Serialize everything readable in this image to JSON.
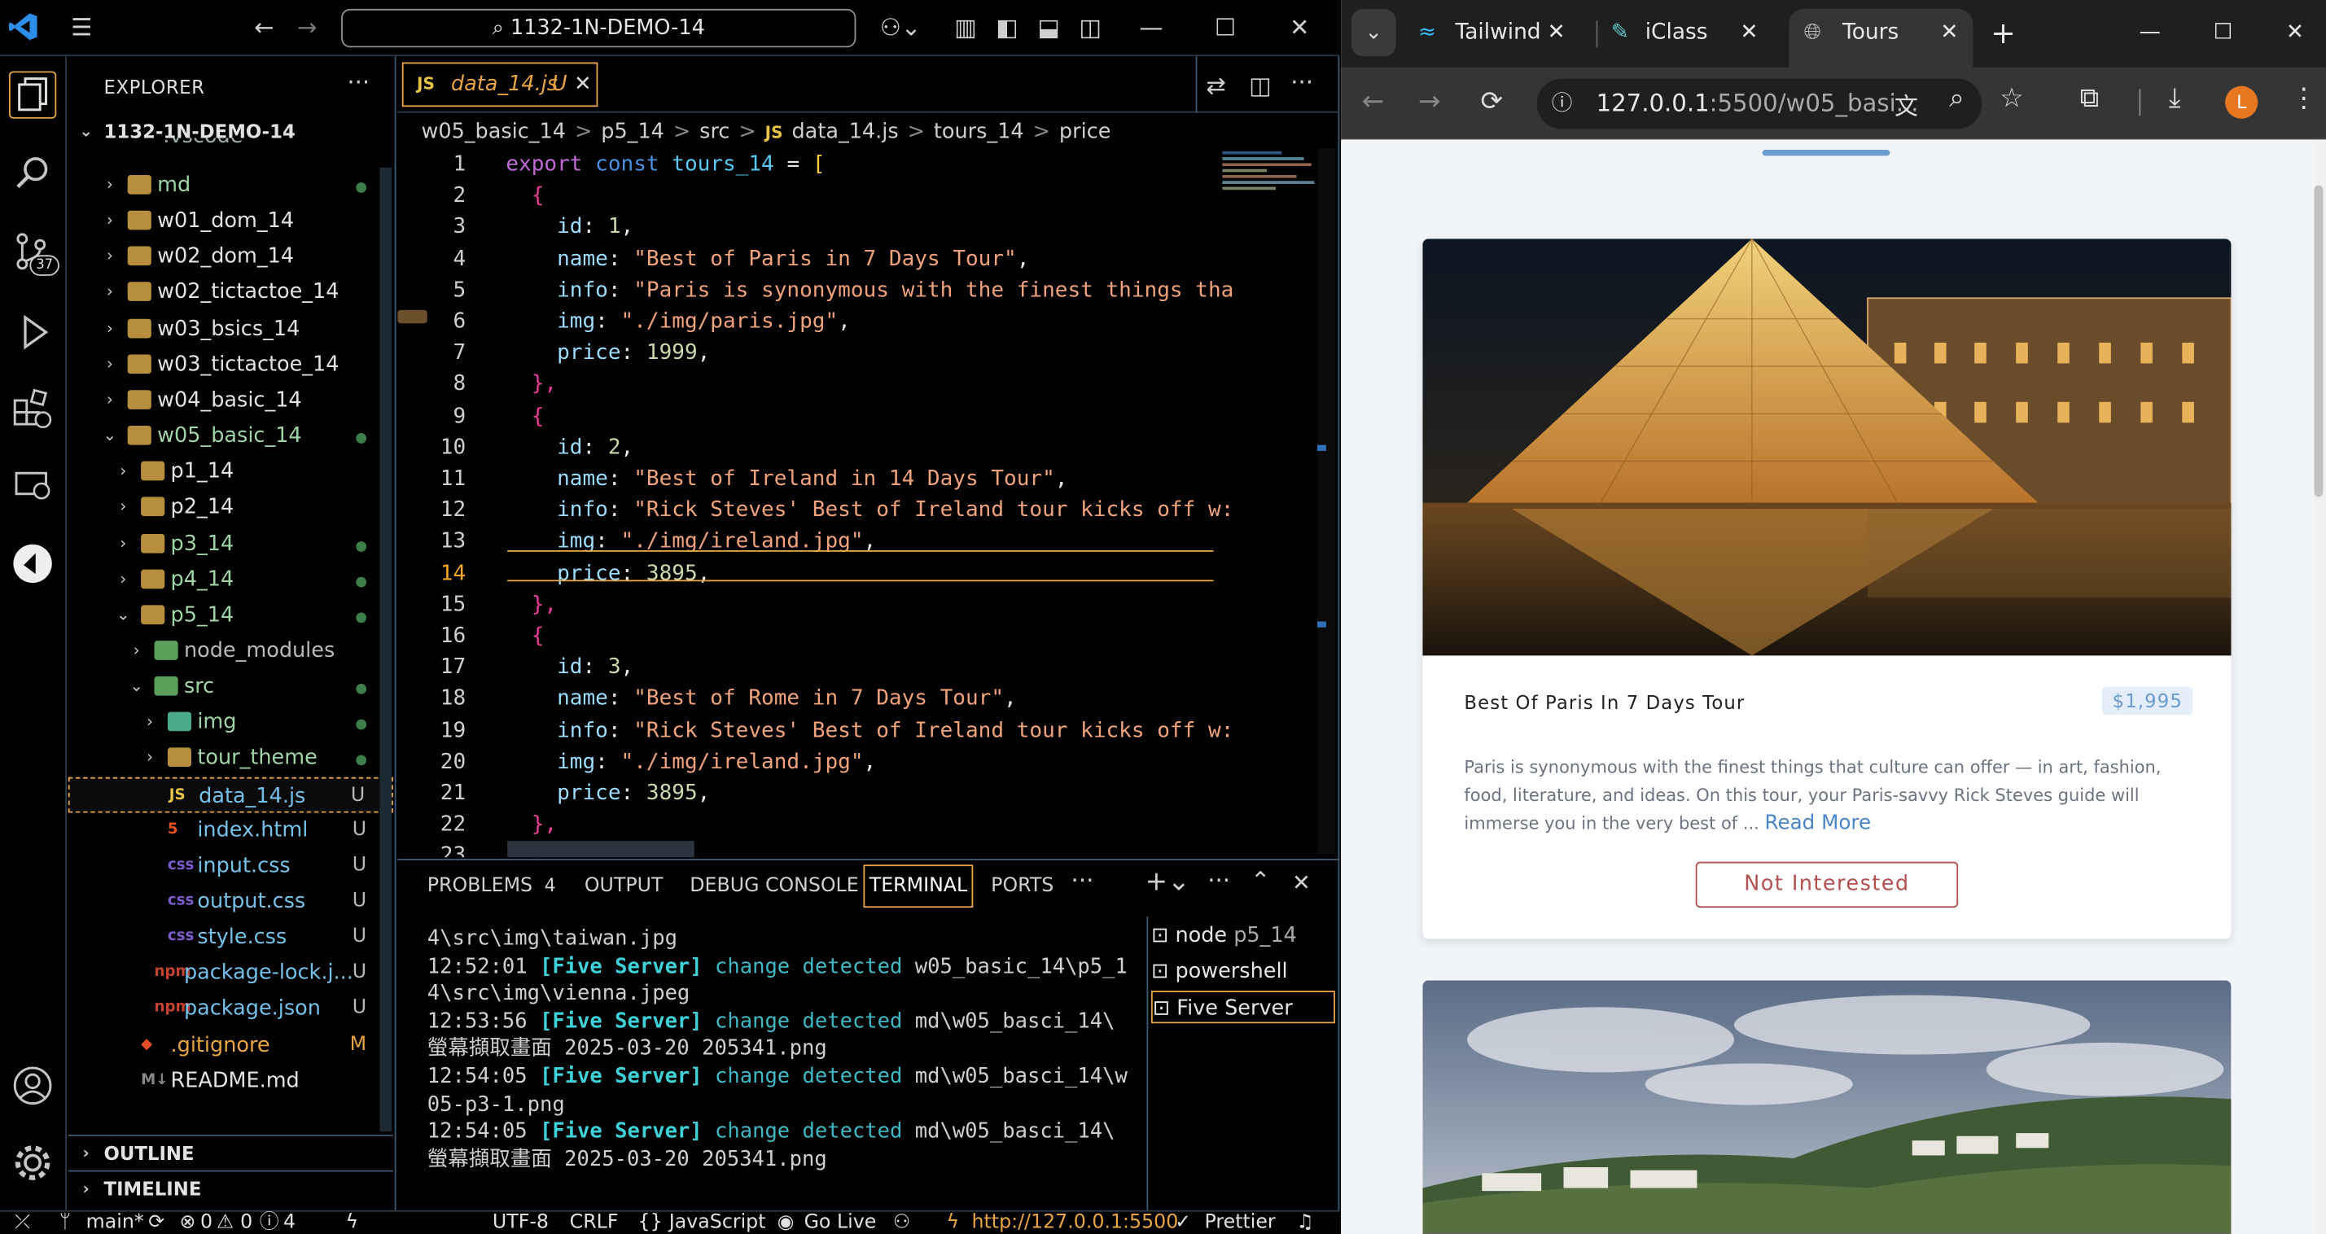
{
  "vscode": {
    "search_text": "1132-1N-DEMO-14",
    "explorer_title": "EXPLORER",
    "root_folder": "1132-1N-DEMO-14",
    "partial_item": ".vscode",
    "tree": [
      {
        "label": "md",
        "depth": 0,
        "kind": "folder",
        "badge": "dot"
      },
      {
        "label": "w01_dom_14",
        "depth": 0,
        "kind": "folder",
        "badge": ""
      },
      {
        "label": "w02_dom_14",
        "depth": 0,
        "kind": "folder",
        "badge": ""
      },
      {
        "label": "w02_tictactoe_14",
        "depth": 0,
        "kind": "folder",
        "badge": ""
      },
      {
        "label": "w03_bsics_14",
        "depth": 0,
        "kind": "folder",
        "badge": ""
      },
      {
        "label": "w03_tictactoe_14",
        "depth": 0,
        "kind": "folder",
        "badge": ""
      },
      {
        "label": "w04_basic_14",
        "depth": 0,
        "kind": "folder",
        "badge": ""
      },
      {
        "label": "w05_basic_14",
        "depth": 0,
        "kind": "folder-open",
        "badge": "dot"
      },
      {
        "label": "p1_14",
        "depth": 1,
        "kind": "folder",
        "badge": ""
      },
      {
        "label": "p2_14",
        "depth": 1,
        "kind": "folder",
        "badge": ""
      },
      {
        "label": "p3_14",
        "depth": 1,
        "kind": "folder",
        "badge": "dot"
      },
      {
        "label": "p4_14",
        "depth": 1,
        "kind": "folder",
        "badge": "dot"
      },
      {
        "label": "p5_14",
        "depth": 1,
        "kind": "folder-open",
        "badge": "dot"
      },
      {
        "label": "node_modules",
        "depth": 2,
        "kind": "folder-green",
        "badge": ""
      },
      {
        "label": "src",
        "depth": 2,
        "kind": "folder-green-open",
        "badge": "dot"
      },
      {
        "label": "img",
        "depth": 3,
        "kind": "folder-img",
        "badge": "dot"
      },
      {
        "label": "tour_theme",
        "depth": 3,
        "kind": "folder",
        "badge": "dot"
      },
      {
        "label": "data_14.js",
        "depth": 3,
        "kind": "js",
        "badge": "U"
      },
      {
        "label": "index.html",
        "depth": 3,
        "kind": "html",
        "badge": "U"
      },
      {
        "label": "input.css",
        "depth": 3,
        "kind": "css",
        "badge": "U"
      },
      {
        "label": "output.css",
        "depth": 3,
        "kind": "css",
        "badge": "U"
      },
      {
        "label": "style.css",
        "depth": 3,
        "kind": "css",
        "badge": "U"
      },
      {
        "label": "package-lock.j...",
        "depth": 2,
        "kind": "npm",
        "badge": "U"
      },
      {
        "label": "package.json",
        "depth": 2,
        "kind": "npm",
        "badge": "U"
      },
      {
        "label": ".gitignore",
        "depth": 1,
        "kind": "git",
        "badge": "M"
      },
      {
        "label": "README.md",
        "depth": 1,
        "kind": "md",
        "badge": ""
      }
    ],
    "outline": "OUTLINE",
    "timeline": "TIMELINE",
    "badge_count": "37",
    "tab_label": "data_14.js",
    "tab_badge": "U",
    "tab_icon": "JS",
    "breadcrumbs": [
      "w05_basic_14",
      ">",
      "p5_14",
      ">",
      "src",
      ">",
      "JS",
      "data_14.js",
      ">",
      "tours_14",
      ">",
      "price"
    ],
    "code": [
      {
        "n": "1",
        "t": "export const tours_14 = ["
      },
      {
        "n": "2",
        "t": "  {"
      },
      {
        "n": "3",
        "t": "    id: 1,"
      },
      {
        "n": "4",
        "t": "    name: \"Best of Paris in 7 Days Tour\","
      },
      {
        "n": "5",
        "t": "    info: \"Paris is synonymous with the finest things tha"
      },
      {
        "n": "6",
        "t": "    img: \"./img/paris.jpg\","
      },
      {
        "n": "7",
        "t": "    price: 1999,"
      },
      {
        "n": "8",
        "t": "  },"
      },
      {
        "n": "9",
        "t": "  {"
      },
      {
        "n": "10",
        "t": "    id: 2,"
      },
      {
        "n": "11",
        "t": "    name: \"Best of Ireland in 14 Days Tour\","
      },
      {
        "n": "12",
        "t": "    info: \"Rick Steves' Best of Ireland tour kicks off w:"
      },
      {
        "n": "13",
        "t": "    img: \"./img/ireland.jpg\","
      },
      {
        "n": "14",
        "t": "    price: 3895,"
      },
      {
        "n": "15",
        "t": "  },"
      },
      {
        "n": "16",
        "t": "  {"
      },
      {
        "n": "17",
        "t": "    id: 3,"
      },
      {
        "n": "18",
        "t": "    name: \"Best of Rome in 7 Days Tour\","
      },
      {
        "n": "19",
        "t": "    info: \"Rick Steves' Best of Ireland tour kicks off w:"
      },
      {
        "n": "20",
        "t": "    img: \"./img/ireland.jpg\","
      },
      {
        "n": "21",
        "t": "    price: 3895,"
      },
      {
        "n": "22",
        "t": "  },"
      },
      {
        "n": "23",
        "t": "  {"
      }
    ],
    "panel_tabs": {
      "problems": "PROBLEMS",
      "problems_count": "4",
      "output": "OUTPUT",
      "debug": "DEBUG CONSOLE",
      "terminal": "TERMINAL",
      "ports": "PORTS"
    },
    "terminal_lines": [
      [
        {
          "c": "",
          "t": "4\\src\\img\\taiwan.jpg"
        }
      ],
      [
        {
          "c": "",
          "t": "12:52:01 "
        },
        {
          "c": "fs",
          "t": "[Five Server]"
        },
        {
          "c": "cy",
          "t": " change detected "
        },
        {
          "c": "",
          "t": "w05_basic_14\\p5_1"
        }
      ],
      [
        {
          "c": "",
          "t": "4\\src\\img\\vienna.jpeg"
        }
      ],
      [
        {
          "c": "",
          "t": "12:53:56 "
        },
        {
          "c": "fs",
          "t": "[Five Server]"
        },
        {
          "c": "cy",
          "t": " change detected "
        },
        {
          "c": "",
          "t": "md\\w05_basci_14\\"
        }
      ],
      [
        {
          "c": "",
          "t": "螢幕擷取畫面 2025-03-20 205341.png"
        }
      ],
      [
        {
          "c": "",
          "t": "12:54:05 "
        },
        {
          "c": "fs",
          "t": "[Five Server]"
        },
        {
          "c": "cy",
          "t": " change detected "
        },
        {
          "c": "",
          "t": "md\\w05_basci_14\\w"
        }
      ],
      [
        {
          "c": "",
          "t": "05-p3-1.png"
        }
      ],
      [
        {
          "c": "",
          "t": "12:54:05 "
        },
        {
          "c": "fs",
          "t": "[Five Server]"
        },
        {
          "c": "cy",
          "t": " change detected "
        },
        {
          "c": "",
          "t": "md\\w05_basci_14\\"
        }
      ],
      [
        {
          "c": "",
          "t": "螢幕擷取畫面 2025-03-20 205341.png"
        }
      ]
    ],
    "terminals": [
      {
        "name": "node",
        "sub": "p5_14"
      },
      {
        "name": "powershell",
        "sub": ""
      },
      {
        "name": "Five Server",
        "sub": ""
      }
    ],
    "status": {
      "branch": "main*",
      "errors": "0",
      "warnings": "0",
      "info": "4",
      "encoding": "UTF-8",
      "eol": "CRLF",
      "lang": "JavaScript",
      "golive": "Go Live",
      "server": "http://127.0.0.1:5500",
      "prettier": "Prettier"
    }
  },
  "chrome": {
    "tabs": [
      {
        "label": "Tailwind"
      },
      {
        "label": "iClass"
      },
      {
        "label": "Tours"
      }
    ],
    "url_host": "127.0.0.1",
    "url_rest": ":5500/w05_basi...",
    "profile_letter": "L",
    "card": {
      "title": "Best Of Paris In 7 Days Tour",
      "price": "$1,995",
      "info": "Paris is synonymous with the finest things that culture can offer — in art, fashion, food, literature, and ideas. On this tour, your Paris-savvy Rick Steves guide will immerse you in the very best of ...",
      "read_more": "Read More",
      "button": "Not Interested"
    }
  }
}
